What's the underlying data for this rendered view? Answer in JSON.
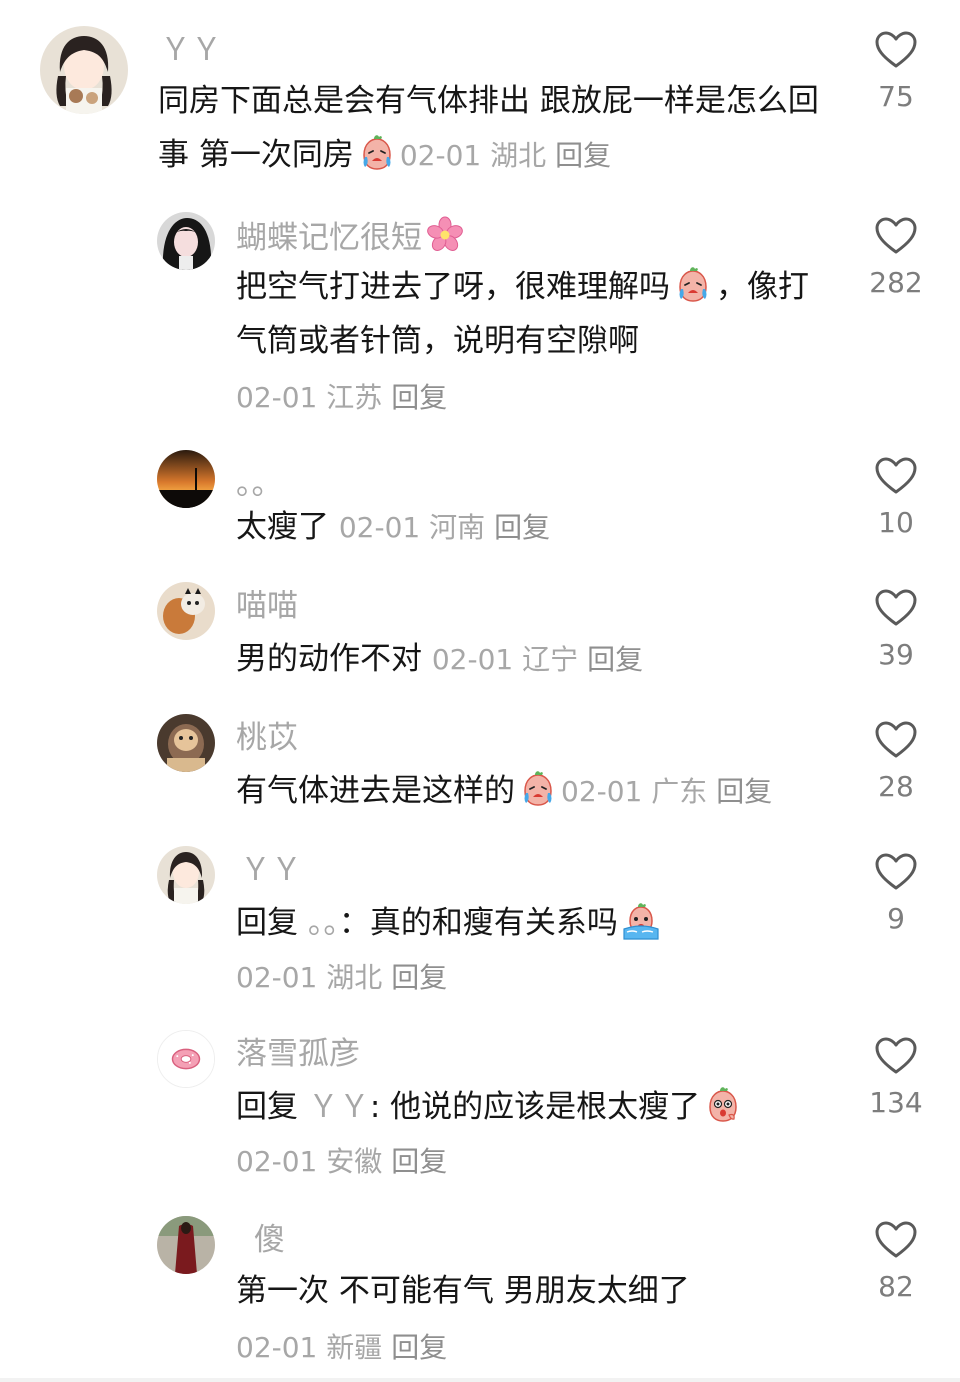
{
  "comments": [
    {
      "username": "ＹＹ",
      "text": "同房下面总是会有气体排出 跟放屁一样是怎么回事 第一次同房",
      "emoji": "crying-face-emoji",
      "date": "02-01",
      "location": "湖北",
      "reply_label": "回复",
      "likes": "75"
    },
    {
      "username": "蝴蝶记忆很短",
      "username_emoji": "cherry-blossom-emoji",
      "text_a": "把空气打进去了呀，很难理解吗",
      "emoji": "crying-face-emoji",
      "text_b": "，像打气筒或者针筒，说明有空隙啊",
      "date": "02-01",
      "location": "江苏",
      "reply_label": "回复",
      "likes": "282"
    },
    {
      "username": "。。",
      "text": "太瘦了",
      "date": "02-01",
      "location": "河南",
      "reply_label": "回复",
      "likes": "10"
    },
    {
      "username": "喵喵",
      "text": "男的动作不对",
      "date": "02-01",
      "location": "辽宁",
      "reply_label": "回复",
      "likes": "39"
    },
    {
      "username": "桃苡",
      "text": "有气体进去是这样的",
      "emoji": "crying-face-emoji",
      "date": "02-01",
      "location": "广东",
      "reply_label": "回复",
      "likes": "28"
    },
    {
      "username": "ＹＹ",
      "reply_prefix": "回复",
      "reply_to": "。。",
      "text": "：真的和瘦有关系吗",
      "emoji": "tearful-face-emoji",
      "date": "02-01",
      "location": "湖北",
      "reply_label": "回复",
      "likes": "9"
    },
    {
      "username": "落雪孤彦",
      "reply_prefix": "回复",
      "reply_to": "ＹＹ",
      "text": ": 他说的应该是根太瘦了",
      "emoji": "surprised-face-emoji",
      "date": "02-01",
      "location": "安徽",
      "reply_label": "回复",
      "likes": "134"
    },
    {
      "username": "傻",
      "text": "第一次 不可能有气 男朋友太细了",
      "date": "02-01",
      "location": "新疆",
      "reply_label": "回复",
      "likes": "82"
    }
  ],
  "colors": {
    "username": "#a7a7a7",
    "text": "#161616",
    "meta": "#a7a7a7",
    "like_icon": "#5a5a5a",
    "like_count": "#7d7d7d"
  }
}
